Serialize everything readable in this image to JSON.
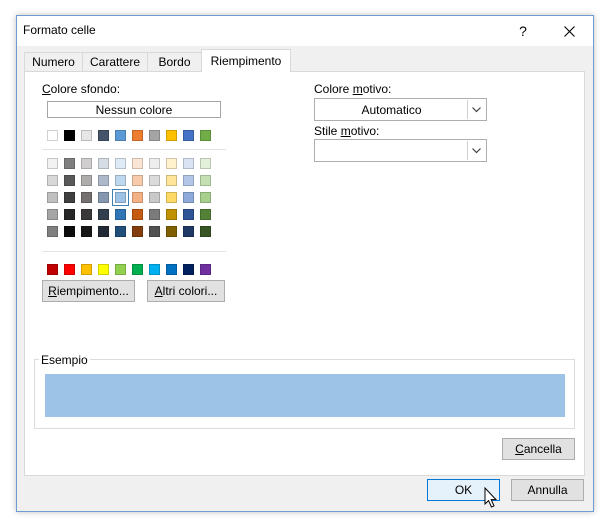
{
  "window": {
    "title": "Formato celle",
    "help_icon": "question-mark-icon",
    "close_icon": "close-icon"
  },
  "tabs": [
    {
      "label": "Numero",
      "active": false
    },
    {
      "label": "Carattere",
      "active": false
    },
    {
      "label": "Bordo",
      "active": false
    },
    {
      "label": "Riempimento",
      "active": true
    }
  ],
  "background": {
    "label_pre": "C",
    "label_rest": "olore sfondo:",
    "no_color_label": "Nessun colore",
    "theme_top": [
      "#ffffff",
      "#000000",
      "#e7e6e6",
      "#44546a",
      "#5b9bd5",
      "#ed7d31",
      "#a5a5a5",
      "#ffc000",
      "#4472c4",
      "#70ad47"
    ],
    "theme_shades": [
      [
        "#f2f2f2",
        "#7f7f7f",
        "#d0cece",
        "#d6dce4",
        "#deebf6",
        "#fbe5d5",
        "#ededed",
        "#fff2cc",
        "#dae3f3",
        "#e2efd9"
      ],
      [
        "#d8d8d8",
        "#595959",
        "#aeabab",
        "#adb9ca",
        "#bdd7ee",
        "#f7cbac",
        "#dbdbdb",
        "#fee599",
        "#b4c6e7",
        "#c5e0b3"
      ],
      [
        "#bfbfbf",
        "#3f3f3f",
        "#757070",
        "#8496b0",
        "#9dc3e6",
        "#f4b183",
        "#c9c9c9",
        "#ffd965",
        "#8eaadb",
        "#a8d08d"
      ],
      [
        "#a5a5a5",
        "#262626",
        "#3a3838",
        "#323f4f",
        "#2e75b5",
        "#c55a11",
        "#7b7b7b",
        "#bf9000",
        "#2f5496",
        "#538135"
      ],
      [
        "#7f7f7f",
        "#0c0c0c",
        "#171616",
        "#222a35",
        "#1e4e79",
        "#833c0b",
        "#525252",
        "#7f6000",
        "#1f3864",
        "#375623"
      ]
    ],
    "selected_swatch": "#9dc3e6",
    "standard": [
      "#c00000",
      "#ff0000",
      "#ffc000",
      "#ffff00",
      "#92d050",
      "#00b050",
      "#00b0f0",
      "#0070c0",
      "#002060",
      "#7030a0"
    ],
    "fill_effects_pre": "R",
    "fill_effects_rest": "iempimento...",
    "more_colors_pre": "A",
    "more_colors_rest": "ltri colori..."
  },
  "pattern": {
    "color_label_pre": "Colore ",
    "color_label_u": "m",
    "color_label_rest": "otivo:",
    "color_value": "Automatico",
    "style_label_pre": "Stile ",
    "style_label_u": "m",
    "style_label_rest": "otivo:",
    "style_value": ""
  },
  "sample": {
    "label": "Esempio",
    "color": "#9dc3e6"
  },
  "buttons": {
    "clear_pre": "C",
    "clear_rest": "ancella",
    "ok": "OK",
    "cancel": "Annulla"
  },
  "colors": {
    "accent": "#0078d7",
    "dialog_bg": "#f0f0f0",
    "window_border": "#6e9bd1"
  }
}
